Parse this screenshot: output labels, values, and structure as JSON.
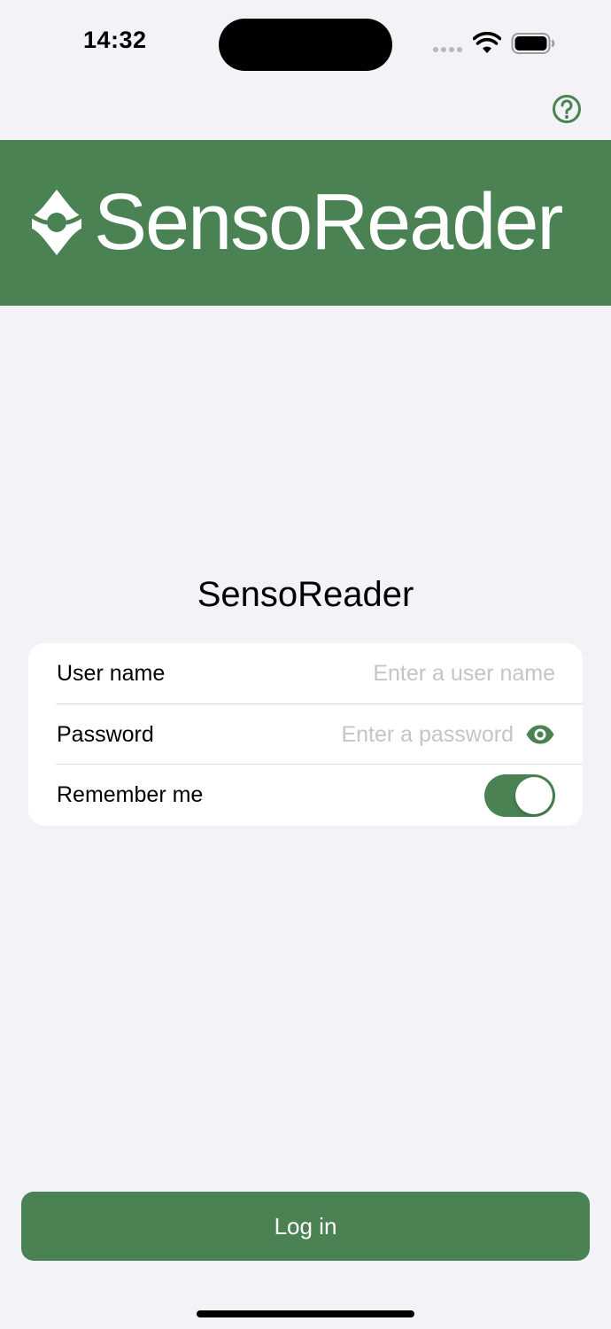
{
  "status_bar": {
    "time": "14:32"
  },
  "icons": {
    "help": "help-circle-icon",
    "brand": "senso-star-icon",
    "wifi": "wifi-icon",
    "battery": "battery-icon",
    "password_visibility": "eye-icon"
  },
  "banner": {
    "wordmark": "SensoReader"
  },
  "login_form": {
    "title": "SensoReader",
    "username": {
      "label": "User name",
      "placeholder": "Enter a user name",
      "value": ""
    },
    "password": {
      "label": "Password",
      "placeholder": "Enter a password",
      "value": ""
    },
    "remember_me": {
      "label": "Remember me",
      "enabled": true
    },
    "submit_label": "Log in"
  },
  "colors": {
    "accent": "#4a8253",
    "background": "#f2f2f7",
    "card": "#ffffff",
    "placeholder": "#c4c4c9"
  }
}
